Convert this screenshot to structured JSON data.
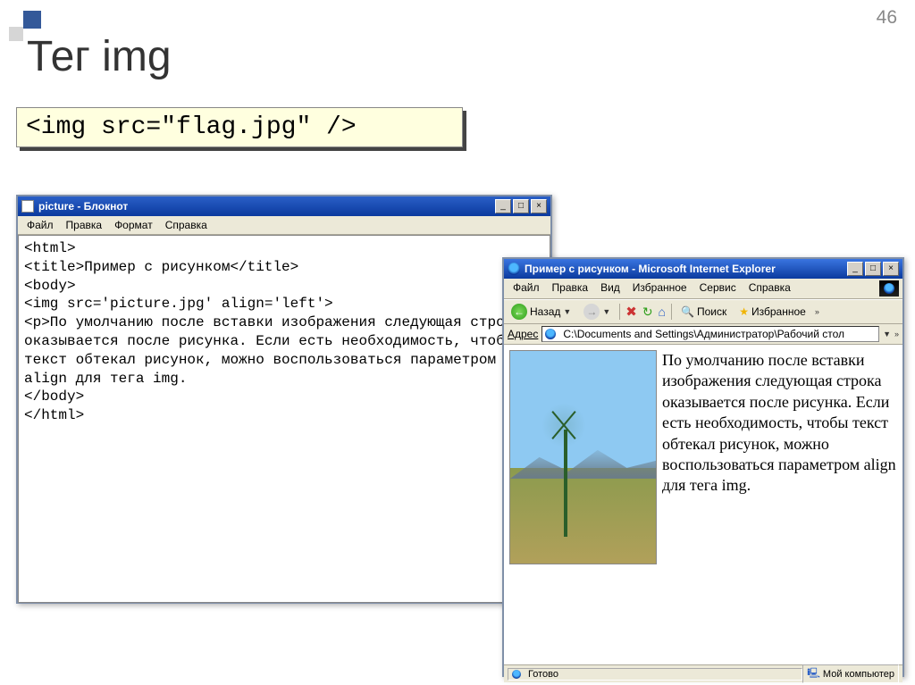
{
  "page_number": "46",
  "slide_title": "Тег img",
  "code_example": "<img src=\"flag.jpg\" />",
  "notepad": {
    "title": "picture - Блокнот",
    "menu": {
      "file": "Файл",
      "edit": "Правка",
      "format": "Формат",
      "help": "Справка"
    },
    "content": "<html>\n<title>Пример с рисунком</title>\n<body>\n<img src='picture.jpg' align='left'>\n<p>По умолчанию после вставки изображения следующая строка оказывается после рисунка. Если есть необходимость, чтобы текст обтекал рисунок, можно воспользоваться параметром align для тега img.\n</body>\n</html>"
  },
  "ie": {
    "title": "Пример с рисунком - Microsoft Internet Explorer",
    "menu": {
      "file": "Файл",
      "edit": "Правка",
      "view": "Вид",
      "favorites": "Избранное",
      "tools": "Сервис",
      "help": "Справка"
    },
    "toolbar": {
      "back": "Назад",
      "search": "Поиск",
      "favorites": "Избранное"
    },
    "address_label": "Адрес",
    "address_value": "C:\\Documents and Settings\\Администратор\\Рабочий стол",
    "body_text": "По умолчанию после вставки изображения следующая строка оказывается после рисунка. Если есть необходимость, чтобы текст обтекал рисунок, можно воспользоваться параметром align для тега img.",
    "status": {
      "ready": "Готово",
      "zone": "Мой компьютер"
    }
  },
  "winctl": {
    "min": "_",
    "max": "□",
    "close": "×"
  }
}
